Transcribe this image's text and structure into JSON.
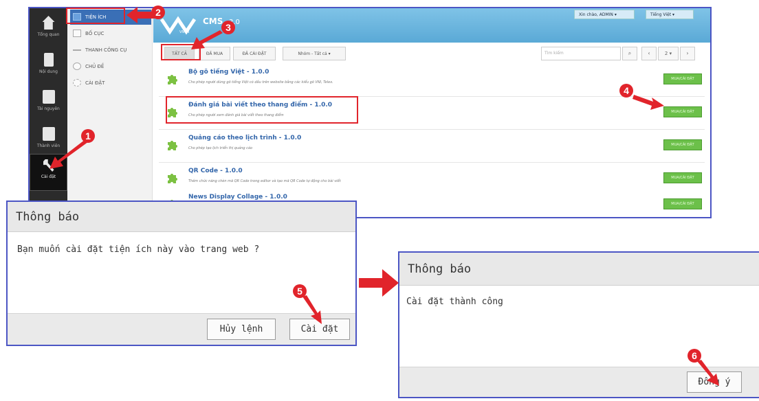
{
  "left_nav": [
    {
      "label": "Tổng quan"
    },
    {
      "label": "Nội dung"
    },
    {
      "label": "Tài nguyên"
    },
    {
      "label": "Thành viên"
    },
    {
      "label": "Cài đặt"
    }
  ],
  "sub_nav": [
    {
      "label": "TIỆN ÍCH"
    },
    {
      "label": "BỐ CỤC"
    },
    {
      "label": "THANH CÔNG CỤ"
    },
    {
      "label": "CHỦ ĐỀ"
    },
    {
      "label": "CÀI ĐẶT"
    }
  ],
  "header": {
    "logo_small": "VNVN",
    "logo_text": "CMS",
    "version": "3.0",
    "greeting": "Xin chào, ADMIN",
    "language": "Tiếng Việt"
  },
  "toolbar": {
    "tabs": [
      "TẤT CẢ",
      "ĐÃ MUA",
      "ĐÃ CÀI ĐẶT",
      "Nhóm - Tất cả"
    ],
    "search_placeholder": "Tìm kiếm",
    "page": "2"
  },
  "plugins": [
    {
      "title": "Bộ gõ tiếng Việt - 1.0.0",
      "desc": "Cho phép người dùng gõ tiếng Việt có dấu trên website bằng các kiểu gõ VNI, Telex.",
      "button": "MUA/CÀI ĐẶT"
    },
    {
      "title": "Đánh giá bài viết theo thang điểm - 1.0.0",
      "desc": "Cho phép người xem đánh giá bài viết theo thang điểm",
      "button": "MUA/CÀI ĐẶT"
    },
    {
      "title": "Quảng cáo theo lịch trình - 1.0.0",
      "desc": "Cho phép tạo lịch triển thị quảng cáo",
      "button": "MUA/CÀI ĐẶT"
    },
    {
      "title": "QR Code - 1.0.0",
      "desc": "Thêm chức năng chèn mã QR Code trong editor và tạo mã QR Code tự động cho bài viết",
      "button": "MUA/CÀI ĐẶT"
    },
    {
      "title": "News Display Collage - 1.0.0",
      "desc": "",
      "button": "MUA/CÀI ĐẶT"
    }
  ],
  "dialog_confirm": {
    "title": "Thông báo",
    "message": "Bạn muốn cài đặt tiện ích này vào trang web ?",
    "cancel": "Hủy lệnh",
    "install": "Cài đặt"
  },
  "dialog_success": {
    "title": "Thông báo",
    "message": "Cài đặt thành công",
    "ok": "Đồng ý"
  },
  "steps": [
    "1",
    "2",
    "3",
    "4",
    "5",
    "6"
  ],
  "colors": {
    "annotation": "#e1242b",
    "frame": "#4b55c4",
    "install_green": "#6cc04a",
    "header_blue": "#6bb6df"
  }
}
